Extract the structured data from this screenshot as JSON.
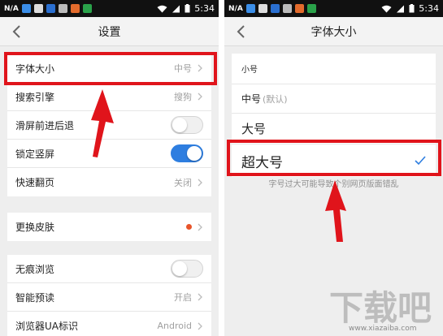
{
  "status_bar": {
    "carrier": "N/A",
    "time": "5:34"
  },
  "left": {
    "title": "设置",
    "group1": [
      {
        "label": "字体大小",
        "value": "中号"
      },
      {
        "label": "搜索引擎",
        "value": "搜狗"
      },
      {
        "label": "滑屏前进后退",
        "toggle": "off"
      },
      {
        "label": "锁定竖屏",
        "toggle": "on"
      },
      {
        "label": "快速翻页",
        "value": "关闭"
      }
    ],
    "group2": [
      {
        "label": "更换皮肤"
      }
    ],
    "group3": [
      {
        "label": "无痕浏览",
        "toggle": "off"
      },
      {
        "label": "智能预读",
        "value": "开启"
      },
      {
        "label": "浏览器UA标识",
        "value": "Android"
      }
    ]
  },
  "right": {
    "title": "字体大小",
    "options": [
      {
        "label": "小号"
      },
      {
        "label": "中号",
        "note": "(默认)"
      },
      {
        "label": "大号"
      },
      {
        "label": "超大号",
        "selected": true
      }
    ],
    "warning": "字号过大可能导致个别网页版面错乱"
  },
  "colors": {
    "accent_blue": "#2e7ee0",
    "highlight_red": "#e0141b",
    "skin_dot": "#e8542a"
  },
  "watermark": {
    "text": "下载吧",
    "url": "www.xiazaiba.com"
  }
}
